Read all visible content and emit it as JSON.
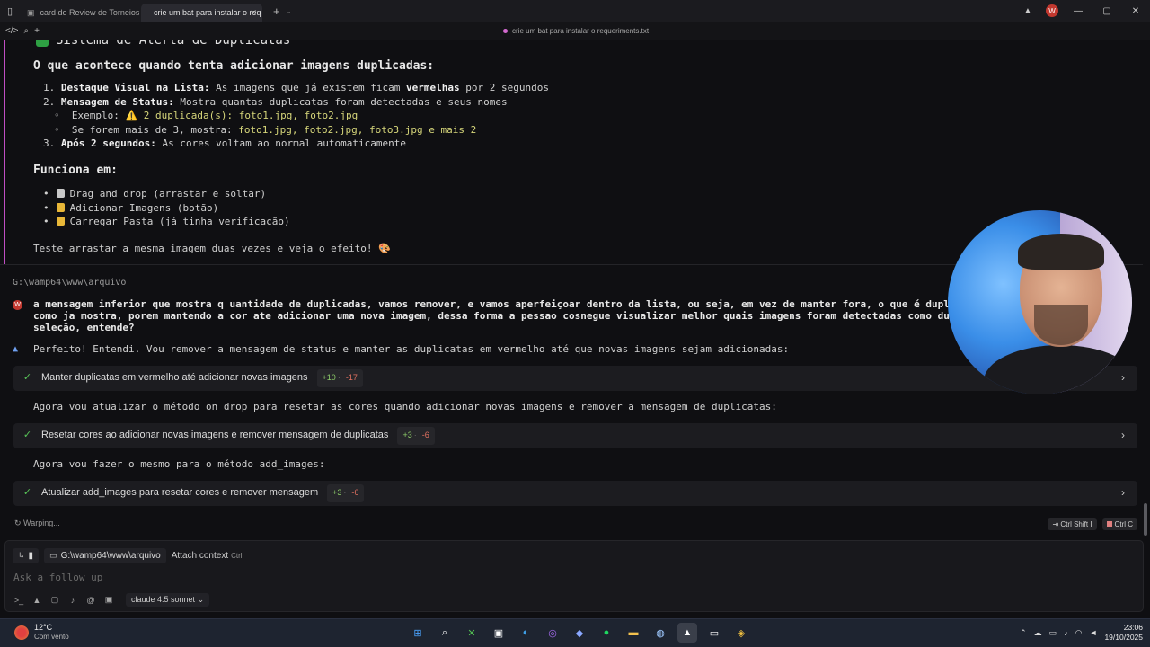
{
  "titlebar": {
    "tabs": [
      {
        "label": "card do Review de Torneios",
        "active": false
      },
      {
        "label": "crie um bat para instalar o req",
        "active": true
      }
    ],
    "avatar_letter": "W"
  },
  "subbar": {
    "doc_title": "crie um bat para instalar o requeriments.txt"
  },
  "content": {
    "cut_heading": "Sistema de Alerta de Duplicatas",
    "heading": "O que acontece quando tenta adicionar imagens duplicadas:",
    "list": [
      {
        "n": "1.",
        "bold": "Destaque Visual na Lista:",
        "pre": " As imagens que já existem ficam ",
        "b2": "vermelhas",
        "post": " por 2 segundos"
      },
      {
        "n": "2.",
        "bold": "Mensagem de Status:",
        "pre": " Mostra quantas duplicatas foram detectadas e seus nomes",
        "b2": "",
        "post": ""
      }
    ],
    "sub1_label": "Exemplo: ",
    "sub1_value": "⚠️ 2 duplicada(s): foto1.jpg, foto2.jpg",
    "sub2_label": "Se forem mais de 3, mostra: ",
    "sub2_value": "foto1.jpg, foto2.jpg, foto3.jpg e mais 2",
    "item3_n": "3.",
    "item3_bold": "Após 2 segundos:",
    "item3_text": " As cores voltam ao normal automaticamente",
    "heading2": "Funciona em:",
    "works": [
      {
        "icon": "document-icon",
        "label": "Drag and drop (arrastar e soltar)"
      },
      {
        "icon": "folder-icon",
        "label": "Adicionar Imagens (botão)"
      },
      {
        "icon": "folder-icon",
        "label": "Carregar Pasta (já tinha verificação)"
      }
    ],
    "teste": "Teste arrastar a mesma imagem duas vezes e veja o efeito! 🎨",
    "path": "G:\\wamp64\\www\\arquivo",
    "user_lines": [
      "a mensagem inferior que mostra q uantidade de duplicadas, vamos remover, e vamos aperfeiçoar dentro da lista, ou seja, em vez de manter fora, o que é duplicado",
      "como ja mostra, porem mantendo a cor ate adicionar uma nova imagem, dessa forma a pessao cosnegue visualizar melhor quais imagens foram detectadas como duplica",
      "seleção, entende?"
    ],
    "ai_reply": "Perfeito! Entendi. Vou remover a mensagem de status e manter as duplicatas em vermelho até que novas imagens sejam adicionadas:",
    "steps": [
      {
        "label": "Manter duplicatas em vermelho até adicionar novas imagens",
        "add": "+10",
        "del": "-17"
      },
      {
        "label": "Resetar cores ao adicionar novas imagens e remover mensagem de duplicatas",
        "add": "+3",
        "del": "-6"
      },
      {
        "label": "Atualizar add_images para resetar cores e remover mensagem",
        "add": "+3",
        "del": "-6"
      }
    ],
    "between1": "Agora vou atualizar o método on_drop para resetar as cores quando adicionar novas imagens e remover a mensagem de duplicatas:",
    "between2": "Agora vou fazer o mesmo para o método add_images:"
  },
  "bottom": {
    "warping": "Warping...",
    "shortcut1": "Ctrl Shift I",
    "shortcut2": "Ctrl C",
    "cwd": "G:\\wamp64\\www\\arquivo",
    "attach": "Attach context",
    "attach_key": "Ctrl",
    "placeholder": "Ask a follow up",
    "model": "claude 4.5 sonnet"
  },
  "taskbar": {
    "temp": "12°C",
    "weather": "Com vento",
    "time": "23:06",
    "date": "19/10/2025"
  },
  "colors": {
    "accent": "#c04ec4",
    "check": "#58c458",
    "add": "#8fcf6a",
    "del": "#e07060"
  }
}
